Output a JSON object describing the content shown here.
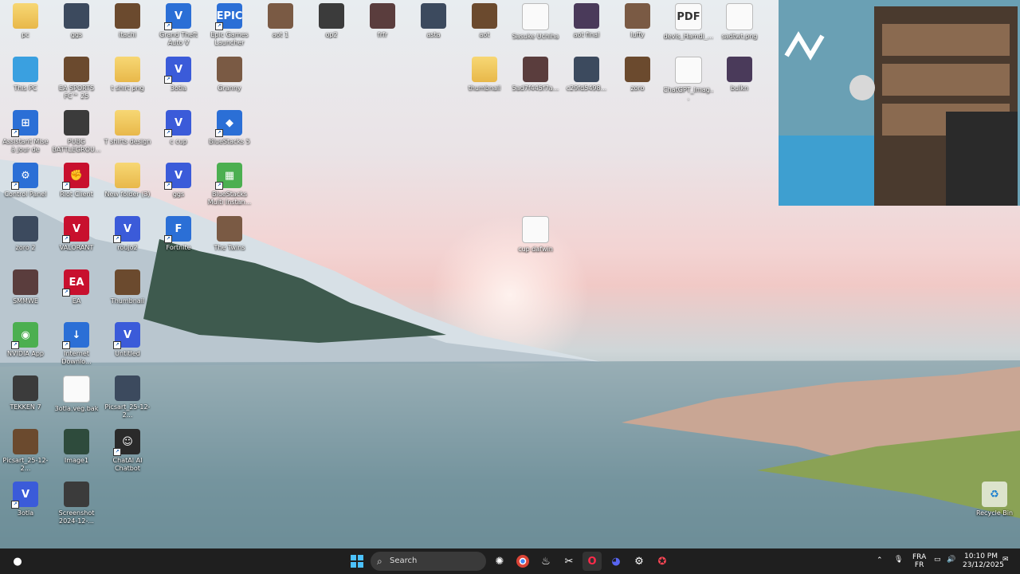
{
  "desktop_icons": [
    {
      "label": "pc",
      "kind": "folder"
    },
    {
      "label": "ggs",
      "kind": "photo"
    },
    {
      "label": "itachi",
      "kind": "photo"
    },
    {
      "label": "Grand Theft Auto V",
      "kind": "app",
      "glyph": "V"
    },
    {
      "label": "Epic Games Launcher",
      "kind": "app",
      "glyph": "EPIC"
    },
    {
      "label": "aot 1",
      "kind": "photo"
    },
    {
      "label": "op2",
      "kind": "photo"
    },
    {
      "label": "frfr",
      "kind": "photo"
    },
    {
      "label": "asta",
      "kind": "photo"
    },
    {
      "label": "aot",
      "kind": "photo"
    },
    {
      "label": "Sasuke Uchiha",
      "kind": "doc"
    },
    {
      "label": "aot final",
      "kind": "photo"
    },
    {
      "label": "luffy",
      "kind": "photo"
    },
    {
      "label": "devis_Hamdi_...",
      "kind": "pdf",
      "glyph": "PDF"
    },
    {
      "label": "sadtwt.png",
      "kind": "doc"
    },
    {
      "label": "This PC",
      "kind": "monitor"
    },
    {
      "label": "EA SPORTS FC™ 25",
      "kind": "photo"
    },
    {
      "label": "t shirt png",
      "kind": "folder"
    },
    {
      "label": "3otla",
      "kind": "vapp",
      "glyph": "V"
    },
    {
      "label": "Granny",
      "kind": "photo"
    },
    {
      "label": "thumbnail",
      "kind": "folder"
    },
    {
      "label": "5ad7f445f7a...",
      "kind": "photo"
    },
    {
      "label": "c29fd5498...",
      "kind": "photo"
    },
    {
      "label": "zoro",
      "kind": "photo"
    },
    {
      "label": "ChatGPT_Imag...",
      "kind": "doc"
    },
    {
      "label": "bulkn",
      "kind": "photo"
    },
    {
      "label": "Assistant Mise à jour de Window...",
      "kind": "app",
      "glyph": "⊞"
    },
    {
      "label": "PUBG BATTLEGROU...",
      "kind": "photo"
    },
    {
      "label": "T shirts design",
      "kind": "folder"
    },
    {
      "label": "c cup",
      "kind": "vapp",
      "glyph": "V"
    },
    {
      "label": "BlueStacks 5",
      "kind": "app",
      "glyph": "◆"
    },
    {
      "label": "Control Panel",
      "kind": "app",
      "glyph": "⚙"
    },
    {
      "label": "Riot Client",
      "kind": "red",
      "glyph": "✊"
    },
    {
      "label": "New folder (3)",
      "kind": "folder"
    },
    {
      "label": "ggs",
      "kind": "vapp",
      "glyph": "V"
    },
    {
      "label": "BlueStacks Multi Instan...",
      "kind": "green",
      "glyph": "▦"
    },
    {
      "label": "zoro 2",
      "kind": "photo"
    },
    {
      "label": "VALORANT",
      "kind": "red",
      "glyph": "V"
    },
    {
      "label": "roujo2",
      "kind": "vapp",
      "glyph": "V"
    },
    {
      "label": "Fortnite",
      "kind": "app",
      "glyph": "F"
    },
    {
      "label": "The Twins",
      "kind": "photo"
    },
    {
      "label": "cup dafwin",
      "kind": "doc"
    },
    {
      "label": "SMMWE",
      "kind": "photo"
    },
    {
      "label": "EA",
      "kind": "red",
      "glyph": "EA"
    },
    {
      "label": "Thumbnail",
      "kind": "photo"
    },
    {
      "label": "NVIDIA App",
      "kind": "green",
      "glyph": "◉"
    },
    {
      "label": "Internet Downlo...",
      "kind": "app",
      "glyph": "↓"
    },
    {
      "label": "Untitled",
      "kind": "vapp",
      "glyph": "V"
    },
    {
      "label": "TEKKEN 7",
      "kind": "photo"
    },
    {
      "label": "3otla.veg.bak",
      "kind": "doc"
    },
    {
      "label": "Picsart_25-12-2...",
      "kind": "photo"
    },
    {
      "label": "Picsart_25-12-2...",
      "kind": "photo"
    },
    {
      "label": "Image1",
      "kind": "photo"
    },
    {
      "label": "ChatAI AI Chatbot",
      "kind": "dark",
      "glyph": "☺"
    },
    {
      "label": "3otla",
      "kind": "vapp",
      "glyph": "V"
    },
    {
      "label": "Screenshot 2024-12-...",
      "kind": "photo"
    },
    {
      "label": "Recycle Bin",
      "kind": "recycle",
      "glyph": "♻"
    }
  ],
  "taskbar": {
    "search_placeholder": "Search",
    "apps": [
      "ChatGPT",
      "Chrome",
      "Steam",
      "Snipping Tool",
      "Opera GX",
      "Discord",
      "Fan app",
      "Riot"
    ],
    "tray": {
      "lang_top": "FRA",
      "lang_bottom": "FR",
      "time": "10:10 PM",
      "date": "23/12/2025"
    }
  },
  "colors": {
    "taskbar": "#1f1f1f",
    "accent": "#0078d4"
  }
}
